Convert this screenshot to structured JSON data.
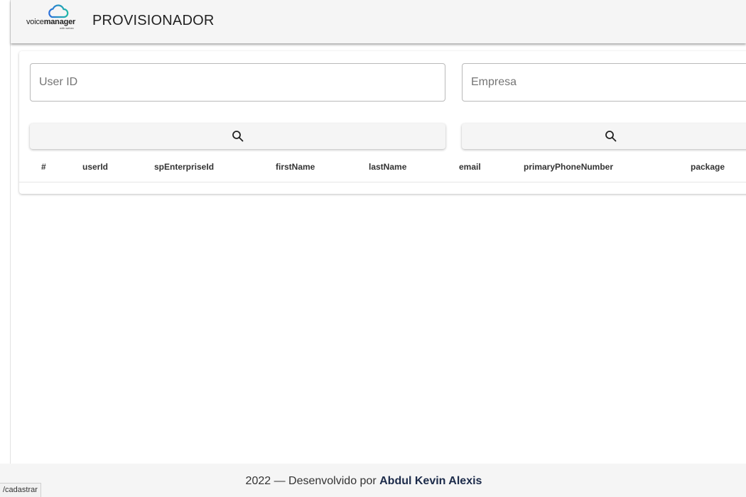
{
  "header": {
    "logo_voice": "voice",
    "logo_manager": "manager",
    "logo_sub": "with webex",
    "title": "PROVISIONADOR"
  },
  "filters": {
    "user_id_placeholder": "User ID",
    "empresa_placeholder": "Empresa"
  },
  "table": {
    "columns": [
      "#",
      "userId",
      "spEnterpriseId",
      "firstName",
      "lastName",
      "email",
      "primaryPhoneNumber",
      "package"
    ],
    "rows": []
  },
  "footer": {
    "text": "2022 — Desenvolvido por ",
    "author": "Abdul Kevin Alexis"
  },
  "status_bar": {
    "url": "/cadastrar"
  },
  "colors": {
    "topbar_bg": "#f5f5f5",
    "author_color": "#1c2b4a",
    "logo_cloud_blue": "#2a6fdb",
    "logo_cloud_teal": "#21b8a8"
  },
  "icons": {
    "logo": "cloud-logo-icon",
    "search": "search-icon"
  }
}
